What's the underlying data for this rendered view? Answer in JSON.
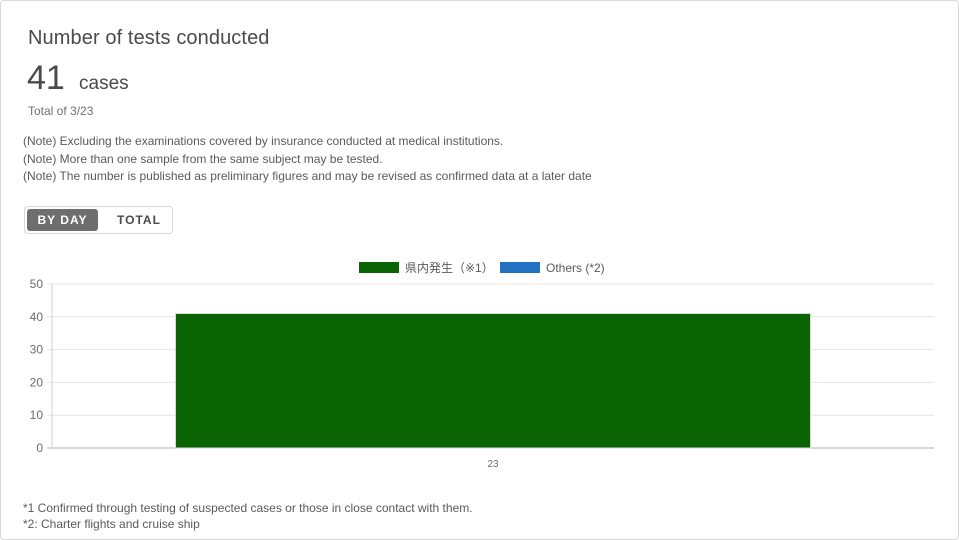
{
  "card": {
    "title": "Number of tests conducted",
    "value": "41",
    "unit": "cases",
    "date_label": "Total of 3/23"
  },
  "notes": [
    "(Note) Excluding the examinations covered by insurance conducted at medical institutions.",
    "(Note) More than one sample from the same subject may be tested.",
    "(Note) The number is published as preliminary figures and may be revised as confirmed data at a later date"
  ],
  "toggle": {
    "by_day_label": "BY DAY",
    "total_label": "TOTAL",
    "selected": "BY DAY"
  },
  "chart_data": {
    "type": "bar",
    "categories": [
      "23"
    ],
    "series": [
      {
        "name": "県内発生（※1）",
        "values": [
          41
        ],
        "color": "#0b6404"
      },
      {
        "name": "Others (*2)",
        "values": [
          0
        ],
        "color": "#2172c2"
      }
    ],
    "stacked": true,
    "ylim": [
      0,
      50
    ],
    "yticks": [
      0,
      10,
      20,
      30,
      40,
      50
    ],
    "grid": true,
    "legend_position": "top-center"
  },
  "footnotes": [
    "*1 Confirmed through testing of suspected cases or those in close contact with them.",
    "*2: Charter flights and cruise ship"
  ]
}
